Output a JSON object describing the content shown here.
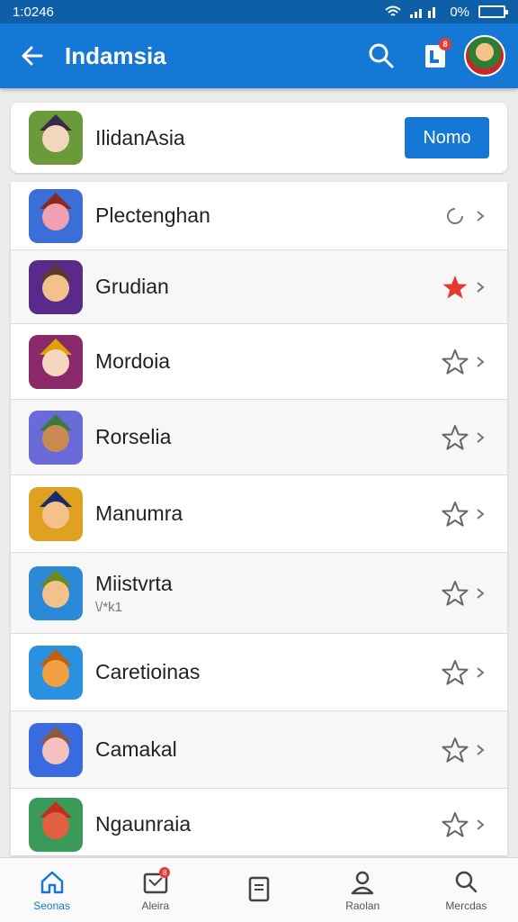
{
  "status_bar": {
    "time": "1:0246",
    "battery": "0%"
  },
  "app_bar": {
    "title": "Indamsia",
    "notification_badge": "8"
  },
  "header_card": {
    "name": "IlidanAsia",
    "button_label": "Nomo"
  },
  "items": [
    {
      "label": "Plectenghan",
      "sub": "",
      "status": "loading-icon",
      "icon_colors": [
        "#3a6fd8",
        "#f2a0b0",
        "#8a2a1a"
      ]
    },
    {
      "label": "Grudian",
      "sub": "",
      "status": "star-filled-icon",
      "icon_colors": [
        "#5a2a8a",
        "#f4c08c",
        "#5a3a2a"
      ]
    },
    {
      "label": "Mordoia",
      "sub": "",
      "status": "star-outline-icon",
      "icon_colors": [
        "#8a2a6a",
        "#f5d7c0",
        "#e0a000"
      ]
    },
    {
      "label": "Rorselia",
      "sub": "",
      "status": "star-outline-icon",
      "icon_colors": [
        "#6a6ad8",
        "#c88a50",
        "#3a7a3a"
      ]
    },
    {
      "label": "Manumra",
      "sub": "",
      "status": "star-outline-icon",
      "icon_colors": [
        "#e0a020",
        "#f4c08c",
        "#1a2a6a"
      ]
    },
    {
      "label": "Miistvrta",
      "sub": "\\/*k1",
      "status": "star-outline-icon",
      "icon_colors": [
        "#2a8ad8",
        "#f4c08c",
        "#6a8a1a"
      ]
    },
    {
      "label": "Caretioinas",
      "sub": "",
      "status": "star-outline-icon",
      "icon_colors": [
        "#2a90e0",
        "#f0a040",
        "#c06010"
      ]
    },
    {
      "label": "Camakal",
      "sub": "",
      "status": "star-outline-icon",
      "icon_colors": [
        "#3a6ae0",
        "#f4c0c0",
        "#8a5a3a"
      ]
    },
    {
      "label": "Ngaunraia",
      "sub": "",
      "status": "star-outline-icon",
      "icon_colors": [
        "#3a9a5a",
        "#e06040",
        "#c03020"
      ]
    }
  ],
  "bottom_nav": [
    {
      "label": "Seonas",
      "icon": "home-icon",
      "active": true
    },
    {
      "label": "Aleira",
      "icon": "ticket-icon",
      "badge": "8"
    },
    {
      "label": "",
      "icon": "document-icon"
    },
    {
      "label": "Raolan",
      "icon": "person-icon"
    },
    {
      "label": "Mercdas",
      "icon": "search-icon"
    }
  ],
  "colors": {
    "primary": "#1478d4",
    "status_bar": "#0f5fa8",
    "accent_star": "#e53935"
  }
}
